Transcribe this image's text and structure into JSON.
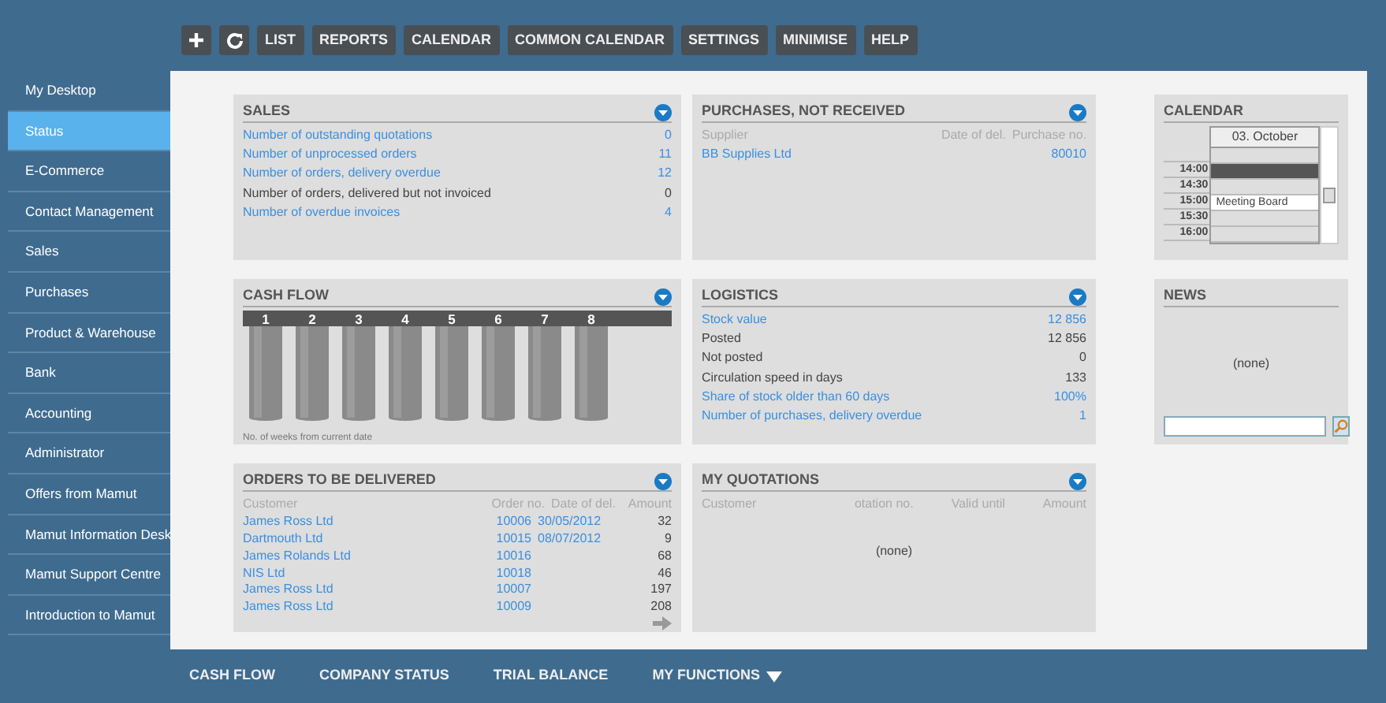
{
  "toolbar": {
    "buttons": [
      "LIST",
      "REPORTS",
      "CALENDAR",
      "COMMON CALENDAR",
      "SETTINGS",
      "MINIMISE",
      "HELP"
    ]
  },
  "sidebar": {
    "items": [
      {
        "label": "My Desktop",
        "selected": false
      },
      {
        "label": "Status",
        "selected": true
      },
      {
        "label": "E-Commerce",
        "selected": false
      },
      {
        "label": "Contact Management",
        "selected": false
      },
      {
        "label": "Sales",
        "selected": false
      },
      {
        "label": "Purchases",
        "selected": false
      },
      {
        "label": "Product & Warehouse",
        "selected": false
      },
      {
        "label": "Bank",
        "selected": false
      },
      {
        "label": "Accounting",
        "selected": false
      },
      {
        "label": "Administrator",
        "selected": false
      },
      {
        "label": "Offers from Mamut",
        "selected": false
      },
      {
        "label": "Mamut Information Desk",
        "selected": false
      },
      {
        "label": "Mamut Support Centre",
        "selected": false
      },
      {
        "label": "Introduction to Mamut",
        "selected": false
      }
    ]
  },
  "sales": {
    "title": "SALES",
    "rows": [
      {
        "label": "Number of outstanding quotations",
        "value": "0",
        "link": true
      },
      {
        "label": "Number of unprocessed orders",
        "value": "11",
        "link": true
      },
      {
        "label": "Number of orders, delivery overdue",
        "value": "12",
        "link": true
      },
      {
        "label": "Number of orders, delivered but not invoiced",
        "value": "0",
        "link": false
      },
      {
        "label": "Number of overdue invoices",
        "value": "4",
        "link": true
      }
    ]
  },
  "purchases": {
    "title": "PURCHASES, NOT RECEIVED",
    "columns": [
      "Supplier",
      "Date of del.",
      "Purchase no."
    ],
    "rows": [
      {
        "supplier": "BB Supplies Ltd",
        "purchase_no": "80010"
      }
    ]
  },
  "calendar": {
    "title": "CALENDAR",
    "date": "03. October",
    "slots": [
      {
        "kind": "empty"
      },
      {
        "time": "14:00",
        "kind": "busy"
      },
      {
        "time": "14:30",
        "kind": "empty"
      },
      {
        "time": "15:00",
        "kind": "event",
        "event": "Meeting Board"
      },
      {
        "time": "15:30",
        "kind": "empty"
      },
      {
        "time": "16:00",
        "kind": "empty"
      }
    ]
  },
  "cash_flow": {
    "title": "CASH FLOW",
    "weeks": [
      "1",
      "2",
      "3",
      "4",
      "5",
      "6",
      "7",
      "8"
    ],
    "caption": "No. of weeks from current date"
  },
  "logistics": {
    "title": "LOGISTICS",
    "rows": [
      {
        "label": "Stock value",
        "value": "12 856",
        "link": true
      },
      {
        "label": "Posted",
        "value": "12 856",
        "link": false
      },
      {
        "label": "Not posted",
        "value": "0",
        "link": false
      },
      {
        "label": "Circulation speed in days",
        "value": "133",
        "link": false
      },
      {
        "label": "Share of stock older than 60 days",
        "value": "100%",
        "link": true
      },
      {
        "label": "Number of purchases, delivery overdue",
        "value": "1",
        "link": true
      }
    ]
  },
  "news": {
    "title": "NEWS",
    "empty_text": "(none)"
  },
  "orders": {
    "title": "ORDERS TO BE DELIVERED",
    "columns": [
      "Customer",
      "Order no.",
      "Date of del.",
      "Amount"
    ],
    "rows": [
      {
        "customer": "James Ross Ltd",
        "order_no": "10006",
        "date": "30/05/2012",
        "amount": "32"
      },
      {
        "customer": "Dartmouth Ltd",
        "order_no": "10015",
        "date": "08/07/2012",
        "amount": "9"
      },
      {
        "customer": "James Rolands Ltd",
        "order_no": "10016",
        "amount": "68"
      },
      {
        "customer": "NIS Ltd",
        "order_no": "10018",
        "amount": "46"
      },
      {
        "customer": "James Ross Ltd",
        "order_no": "10007",
        "amount": "197"
      },
      {
        "customer": "James Ross Ltd",
        "order_no": "10009",
        "amount": "208"
      }
    ]
  },
  "quotations": {
    "title": "MY QUOTATIONS",
    "columns": [
      "Customer",
      "otation no.",
      "Valid until",
      "Amount"
    ],
    "empty_text": "(none)"
  },
  "bottom_bar": {
    "links": [
      {
        "label": "CASH FLOW",
        "kind": "plain"
      },
      {
        "label": "COMPANY STATUS",
        "kind": "plain"
      },
      {
        "label": "TRIAL BALANCE",
        "kind": "plain"
      },
      {
        "label": "MY FUNCTIONS",
        "kind": "dropdown"
      }
    ]
  }
}
